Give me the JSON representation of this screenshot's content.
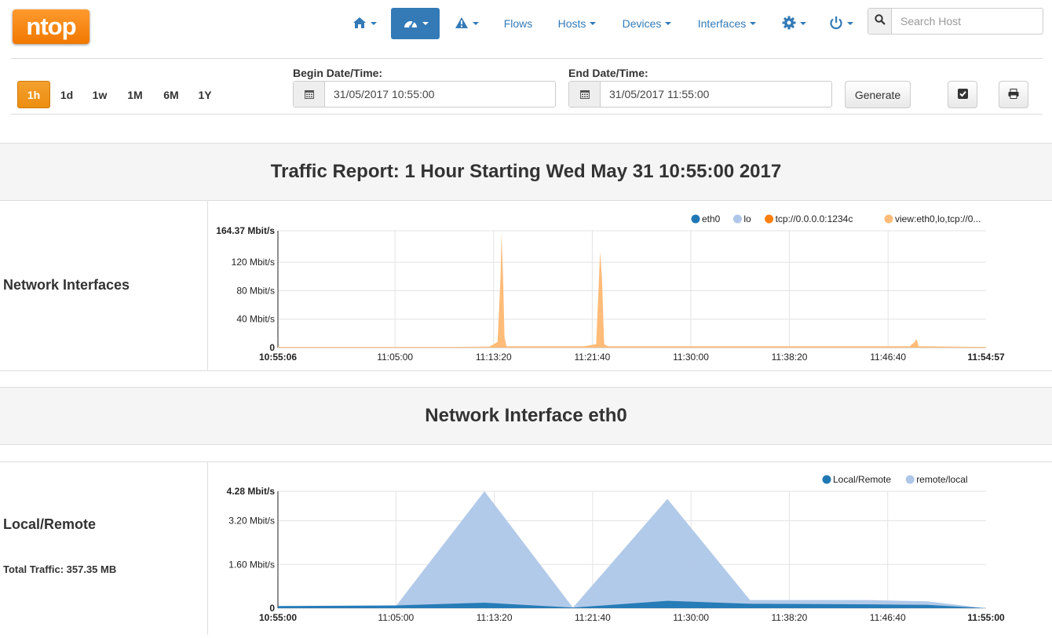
{
  "brand": {
    "logo": "ntop"
  },
  "nav": {
    "flows": "Flows",
    "hosts": "Hosts",
    "devices": "Devices",
    "interfaces": "Interfaces",
    "search_placeholder": "Search Host"
  },
  "toolbar": {
    "ranges": [
      "1h",
      "1d",
      "1w",
      "1M",
      "6M",
      "1Y"
    ],
    "active_range": "1h",
    "begin_label": "Begin Date/Time:",
    "begin_value": "31/05/2017 10:55:00",
    "end_label": "End Date/Time:",
    "end_value": "31/05/2017 11:55:00",
    "generate": "Generate"
  },
  "report": {
    "title": "Traffic Report: 1 Hour Starting Wed May 31 10:55:00 2017",
    "iface_section": "Network Interface eth0"
  },
  "rows": {
    "net_ifaces": "Network Interfaces",
    "local_remote": "Local/Remote",
    "total_traffic": "Total Traffic: 357.35 MB"
  },
  "colors": {
    "accent": "#337ab7",
    "brand": "#f08c1a",
    "eth0": "#1f77b4",
    "lo": "#aec7e8",
    "tcp": "#ff7f0e",
    "view": "#ffbb78"
  },
  "chart_data": [
    {
      "type": "area",
      "legend": [
        "eth0",
        "lo",
        "tcp://0.0.0.0:1234c",
        "view:eth0,lo,tcp://0..."
      ],
      "legend_position": "top-right",
      "y_ticks": [
        "0",
        "40 Mbit/s",
        "80 Mbit/s",
        "120 Mbit/s",
        "164.37 Mbit/s"
      ],
      "y_max": 164.37,
      "x_ticks": [
        "10:55:06",
        "11:05:00",
        "11:13:20",
        "11:21:40",
        "11:30:00",
        "11:38:20",
        "11:46:40",
        "11:54:57"
      ],
      "x_range_sec": [
        6,
        3597
      ],
      "series": [
        {
          "name": "eth0",
          "color": "#4a8fc6",
          "points": [
            [
              6,
              0.5
            ],
            [
              900,
              0.5
            ],
            [
              1080,
              1
            ],
            [
              1120,
              5
            ],
            [
              1135,
              45
            ],
            [
              1145,
              60
            ],
            [
              1152,
              10
            ],
            [
              1165,
              1
            ],
            [
              1560,
              1
            ],
            [
              1620,
              3
            ],
            [
              1638,
              65
            ],
            [
              1648,
              50
            ],
            [
              1660,
              3
            ],
            [
              1680,
              1
            ],
            [
              3210,
              1
            ],
            [
              3240,
              4
            ],
            [
              3250,
              1
            ],
            [
              3597,
              0.5
            ]
          ]
        },
        {
          "name": "view:eth0,lo,tcp://0...",
          "color": "#ffbb78",
          "points": [
            [
              6,
              1
            ],
            [
              900,
              1
            ],
            [
              1080,
              1.5
            ],
            [
              1120,
              8
            ],
            [
              1135,
              100
            ],
            [
              1140,
              160
            ],
            [
              1148,
              95
            ],
            [
              1155,
              15
            ],
            [
              1165,
              2
            ],
            [
              1560,
              2
            ],
            [
              1620,
              5
            ],
            [
              1640,
              135
            ],
            [
              1650,
              95
            ],
            [
              1660,
              5
            ],
            [
              1680,
              2
            ],
            [
              3210,
              2
            ],
            [
              3235,
              8
            ],
            [
              3245,
              12
            ],
            [
              3255,
              2
            ],
            [
              3597,
              1
            ]
          ]
        }
      ]
    },
    {
      "type": "area",
      "legend": [
        "Local/Remote",
        "remote/local"
      ],
      "legend_position": "top-right",
      "y_ticks": [
        "0",
        "1.60 Mbit/s",
        "3.20 Mbit/s",
        "4.28 Mbit/s"
      ],
      "y_max": 4.28,
      "x_ticks": [
        "10:55:00",
        "11:05:00",
        "11:13:20",
        "11:21:40",
        "11:30:00",
        "11:38:20",
        "11:46:40",
        "11:55:00"
      ],
      "x_range_sec": [
        0,
        3600
      ],
      "series": [
        {
          "name": "remote/local",
          "color": "#aec7e8",
          "points": [
            [
              0,
              0.05
            ],
            [
              600,
              0.08
            ],
            [
              1050,
              4.28
            ],
            [
              1500,
              0.02
            ],
            [
              1980,
              4.0
            ],
            [
              2400,
              0.3
            ],
            [
              3000,
              0.3
            ],
            [
              3300,
              0.25
            ],
            [
              3600,
              0
            ]
          ]
        },
        {
          "name": "Local/Remote",
          "color": "#1f77b4",
          "points": [
            [
              0,
              0.08
            ],
            [
              600,
              0.1
            ],
            [
              1050,
              0.2
            ],
            [
              1500,
              0.02
            ],
            [
              1980,
              0.27
            ],
            [
              2400,
              0.16
            ],
            [
              3000,
              0.14
            ],
            [
              3300,
              0.12
            ],
            [
              3600,
              0
            ]
          ]
        }
      ]
    }
  ]
}
